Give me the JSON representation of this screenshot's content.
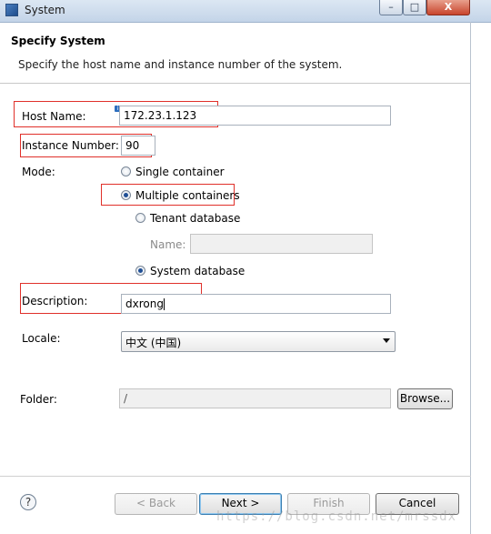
{
  "window": {
    "title": "System",
    "minimize": "–",
    "maximize": "□",
    "close": "X"
  },
  "header": {
    "title": "Specify System",
    "description": "Specify the host name and instance number of the system."
  },
  "form": {
    "host_name_label": "Host Name:",
    "host_name_value": "172.23.1.123",
    "instance_number_label": "Instance Number:",
    "instance_number_value": "90",
    "mode_label": "Mode:",
    "mode_single": "Single container",
    "mode_multiple": "Multiple containers",
    "tenant_database": "Tenant database",
    "name_label": "Name:",
    "name_value": "",
    "system_database": "System database",
    "description_label": "Description:",
    "description_value": "dxrong",
    "locale_label": "Locale:",
    "locale_value": "中文 (中国)",
    "folder_label": "Folder:",
    "folder_value": "/",
    "browse_button": "Browse..."
  },
  "footer": {
    "help": "?",
    "back": "< Back",
    "next": "Next >",
    "finish": "Finish",
    "cancel": "Cancel"
  },
  "watermark": "https://blog.csdn.net/mrssdx",
  "colors": {
    "highlight_box": "#e0302a",
    "titlebar": "#c3d4e8"
  }
}
